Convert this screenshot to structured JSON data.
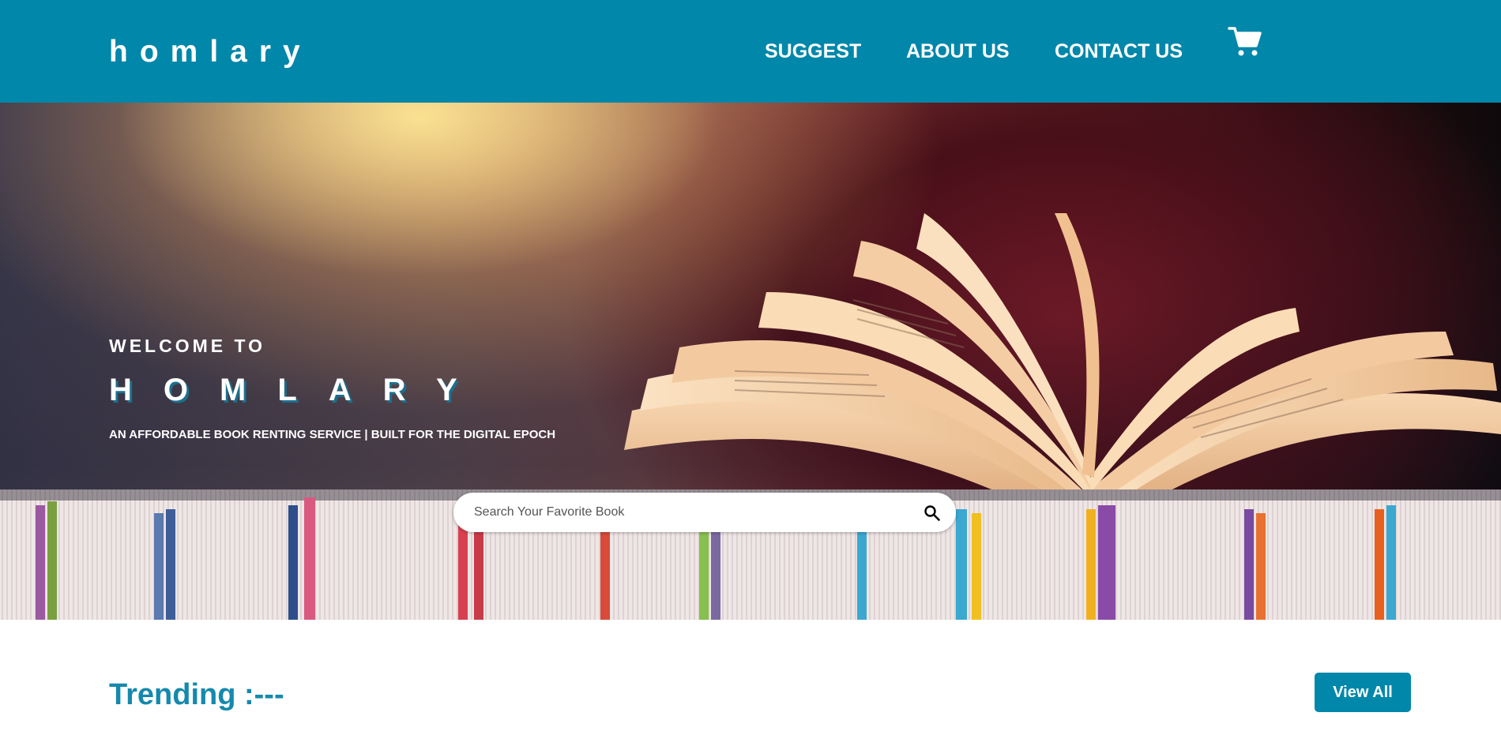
{
  "header": {
    "brand": "homlary",
    "nav": [
      {
        "label": "SUGGEST"
      },
      {
        "label": "ABOUT US"
      },
      {
        "label": "CONTACT US"
      }
    ],
    "cart_icon": "shopping-cart-icon"
  },
  "hero": {
    "welcome": "WELCOME TO",
    "title": "HOMLARY",
    "tagline": "AN AFFORDABLE BOOK RENTING SERVICE | BUILT FOR THE DIGITAL EPOCH",
    "search": {
      "placeholder": "Search Your Favorite Book",
      "value": "",
      "icon": "search-icon"
    }
  },
  "trending": {
    "title": "Trending :---",
    "view_all_label": "View All"
  },
  "colors": {
    "primary": "#0087aa",
    "heading": "#1589ad",
    "white": "#ffffff"
  }
}
